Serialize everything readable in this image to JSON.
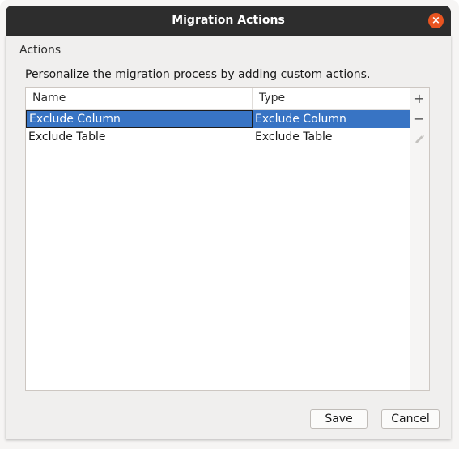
{
  "window": {
    "title": "Migration Actions",
    "close_glyph": "×"
  },
  "section": {
    "label": "Actions",
    "description": "Personalize the migration process by adding custom actions."
  },
  "table": {
    "columns": [
      "Name",
      "Type"
    ],
    "rows": [
      {
        "name": "Exclude Column",
        "type": "Exclude Column",
        "selected": true
      },
      {
        "name": "Exclude Table",
        "type": "Exclude Table",
        "selected": false
      }
    ]
  },
  "toolbar": {
    "add_glyph": "+",
    "remove_glyph": "−",
    "edit_icon": "pencil-icon"
  },
  "buttons": {
    "save": "Save",
    "cancel": "Cancel"
  },
  "colors": {
    "titlebar": "#2d2d2d",
    "close": "#e95420",
    "selection": "#3874c4"
  }
}
